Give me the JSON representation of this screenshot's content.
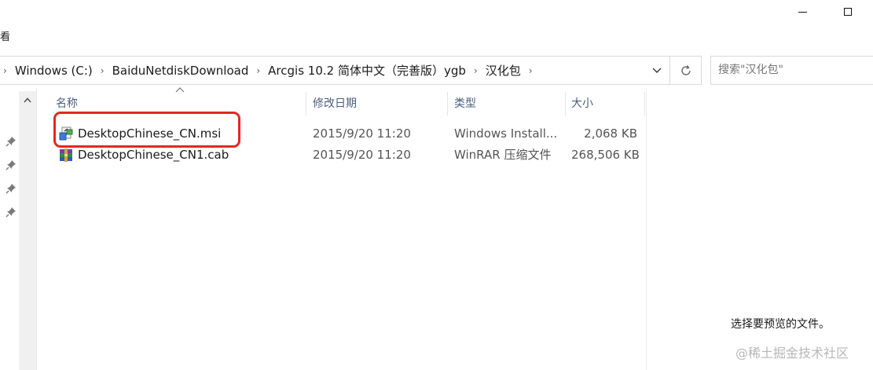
{
  "ribbon": {
    "view_tab": "看"
  },
  "address": {
    "crumbs": [
      "Windows (C:)",
      "BaiduNetdiskDownload",
      "Arcgis 10.2 简体中文（完善版）ygb",
      "汉化包"
    ]
  },
  "search": {
    "placeholder": "搜索\"汉化包\""
  },
  "columns": {
    "name": "名称",
    "date": "修改日期",
    "type": "类型",
    "size": "大小"
  },
  "files": [
    {
      "name": "DesktopChinese_CN.msi",
      "date": "2015/9/20 11:20",
      "type": "Windows Install...",
      "size": "2,068 KB",
      "icon": "msi-installer-icon",
      "highlighted": true
    },
    {
      "name": "DesktopChinese_CN1.cab",
      "date": "2015/9/20 11:20",
      "type": "WinRAR 压缩文件",
      "size": "268,506 KB",
      "icon": "winrar-archive-icon",
      "highlighted": false
    }
  ],
  "preview": {
    "message": "选择要预览的文件。"
  },
  "watermark": {
    "text": "@稀土掘金技术社区"
  },
  "colors": {
    "highlight_border": "#e5271f",
    "header_text": "#4c607a"
  }
}
